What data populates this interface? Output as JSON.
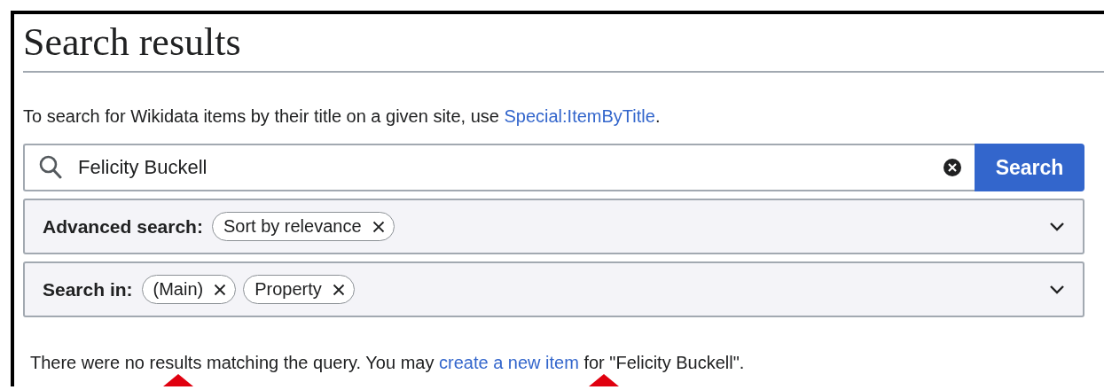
{
  "title": "Search results",
  "intro": {
    "before": "To search for Wikidata items by their title on a given site, use ",
    "link": "Special:ItemByTitle",
    "after": "."
  },
  "search": {
    "value": "Felicity Buckell",
    "button": "Search"
  },
  "panels": [
    {
      "label": "Advanced search:",
      "chips": [
        "Sort by relevance"
      ],
      "expanded": false
    },
    {
      "label": "Search in:",
      "chips": [
        "(Main)",
        "Property"
      ],
      "expanded": false
    }
  ],
  "result": {
    "before": "There were no results matching the query. You may ",
    "link": "create a new item",
    "after": " for \"Felicity Buckell\"."
  }
}
